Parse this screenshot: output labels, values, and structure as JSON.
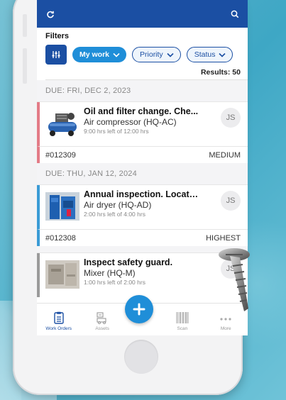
{
  "filters": {
    "label": "Filters",
    "chips": [
      {
        "label": "My work",
        "active": true
      },
      {
        "label": "Priority",
        "active": false
      },
      {
        "label": "Status",
        "active": false
      }
    ],
    "results": "Results: 50"
  },
  "orders": [
    {
      "due": "DUE: FRI, DEC 2, 2023",
      "title": "Oil and filter change. Che...",
      "asset": "Air compressor (HQ-AC)",
      "hours": "9:00 hrs left of 12:00 hrs",
      "assignee": "JS",
      "id": "#012309",
      "priority": "MEDIUM",
      "accent": "#e37b86"
    },
    {
      "due": "DUE: THU, JAN 12, 2024",
      "title": "Annual inspection. Locate...",
      "asset": "Air dryer (HQ-AD)",
      "hours": "2:00 hrs left of 4:00 hrs",
      "assignee": "JS",
      "id": "#012308",
      "priority": "HIGHEST",
      "accent": "#3a9bd5"
    },
    {
      "title": "Inspect safety guard.",
      "asset": "Mixer (HQ-M)",
      "hours": "1:00 hrs left of 2:00 hrs",
      "assignee": "JS",
      "accent": "#9a9a9a"
    }
  ],
  "tabbar": {
    "work_orders": "Work Orders",
    "assets": "Assets",
    "scan": "Scan",
    "more": "More"
  },
  "icons": {
    "refresh": "refresh-icon",
    "search": "search-icon",
    "filter": "sliders-icon",
    "add": "plus-icon"
  },
  "colors": {
    "header": "#1b4fa3",
    "accent_blue": "#1f8ed8",
    "medium": "#e37b86",
    "highest": "#3a9bd5"
  }
}
